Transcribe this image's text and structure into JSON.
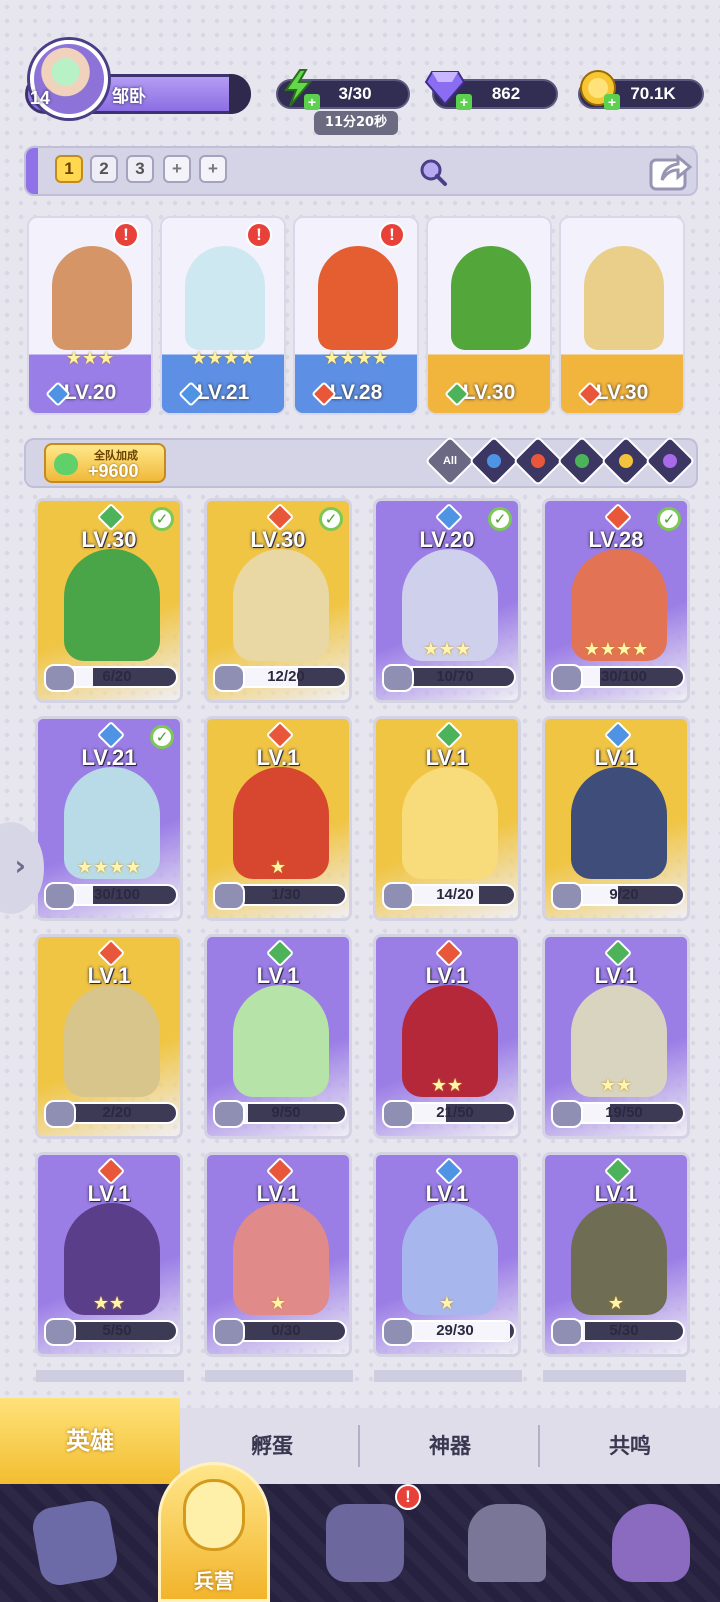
{
  "profile": {
    "name": "邹卧",
    "level": "14"
  },
  "resources": {
    "energy": "3/30",
    "gems": "862",
    "gold": "70.1K",
    "timer": "11分20秒",
    "plus": "+"
  },
  "team_tabs": [
    "1",
    "2",
    "3",
    "+",
    "+"
  ],
  "team_cards": [
    {
      "lv": "LV.20",
      "stars": "★★★",
      "alert": "!",
      "element": "water",
      "bg": "#9a7ee8",
      "art": "#d59566"
    },
    {
      "lv": "LV.21",
      "stars": "★★★★",
      "alert": "!",
      "element": "water",
      "bg": "#5d8fe4",
      "art": "#cde8f0"
    },
    {
      "lv": "LV.28",
      "stars": "★★★★",
      "alert": "!",
      "element": "fire",
      "bg": "#5d8fe4",
      "art": "#e45e32"
    },
    {
      "lv": "LV.30",
      "stars": "",
      "alert": "",
      "element": "wind",
      "bg": "#f1b43d",
      "art": "#52a63a"
    },
    {
      "lv": "LV.30",
      "stars": "",
      "alert": "",
      "element": "fire",
      "bg": "#f1b43d",
      "art": "#eacf8a"
    }
  ],
  "bonus": {
    "label": "全队加成",
    "value": "+9600"
  },
  "filters": {
    "all": "All"
  },
  "heroes": [
    {
      "lv": "LV.30",
      "progress": "6/20",
      "stars": "",
      "check": true,
      "bg": "#f0c544",
      "art": "#4aa548",
      "elem": "#4cb35b"
    },
    {
      "lv": "LV.30",
      "progress": "12/20",
      "stars": "",
      "check": true,
      "bg": "#f0c544",
      "art": "#e9d8a4",
      "elem": "#e9573a"
    },
    {
      "lv": "LV.20",
      "progress": "10/70",
      "stars": "★★★",
      "check": true,
      "bg": "#9b7de6",
      "art": "#cfd0ec",
      "elem": "#4f93e4"
    },
    {
      "lv": "LV.28",
      "progress": "30/100",
      "stars": "★★★★",
      "check": true,
      "bg": "#9b7de6",
      "art": "#e27455",
      "elem": "#e9573a"
    },
    {
      "lv": "LV.21",
      "progress": "30/100",
      "stars": "★★★★",
      "check": true,
      "bg": "#9b7de6",
      "art": "#b9dbe8",
      "elem": "#4f93e4"
    },
    {
      "lv": "LV.1",
      "progress": "1/30",
      "stars": "★",
      "check": false,
      "bg": "#f0c544",
      "art": "#d7472f",
      "elem": "#e9573a"
    },
    {
      "lv": "LV.1",
      "progress": "14/20",
      "stars": "",
      "check": false,
      "bg": "#f0c544",
      "art": "#f8dc7c",
      "elem": "#4cb35b"
    },
    {
      "lv": "LV.1",
      "progress": "9/20",
      "stars": "",
      "check": false,
      "bg": "#f0c544",
      "art": "#3f4d7a",
      "elem": "#4f93e4"
    },
    {
      "lv": "LV.1",
      "progress": "2/20",
      "stars": "",
      "check": false,
      "bg": "#f0c544",
      "art": "#d7c58c",
      "elem": "#e9573a"
    },
    {
      "lv": "LV.1",
      "progress": "9/50",
      "stars": "",
      "check": false,
      "bg": "#9b7de6",
      "art": "#b6e3a8",
      "elem": "#4cb35b"
    },
    {
      "lv": "LV.1",
      "progress": "21/50",
      "stars": "★★",
      "check": false,
      "bg": "#9b7de6",
      "art": "#b5283a",
      "elem": "#e9573a"
    },
    {
      "lv": "LV.1",
      "progress": "19/50",
      "stars": "★★",
      "check": false,
      "bg": "#9b7de6",
      "art": "#d8d4c0",
      "elem": "#4cb35b"
    },
    {
      "lv": "LV.1",
      "progress": "5/50",
      "stars": "★★",
      "check": false,
      "bg": "#9b7de6",
      "art": "#5a3e8a",
      "elem": "#e9573a"
    },
    {
      "lv": "LV.1",
      "progress": "0/30",
      "stars": "★",
      "check": false,
      "bg": "#9b7de6",
      "art": "#e08a8a",
      "elem": "#e9573a"
    },
    {
      "lv": "LV.1",
      "progress": "29/30",
      "stars": "★",
      "check": false,
      "bg": "#9b7de6",
      "art": "#a8b6ee",
      "elem": "#4f93e4"
    },
    {
      "lv": "LV.1",
      "progress": "5/30",
      "stars": "★",
      "check": false,
      "bg": "#9b7de6",
      "art": "#6f6d54",
      "elem": "#4cb35b"
    }
  ],
  "subtabs": [
    "英雄",
    "孵蛋",
    "神器",
    "共鸣"
  ],
  "nav": {
    "center_label": "兵营",
    "alert": "!"
  },
  "icons": {
    "side_arrow": "›"
  }
}
